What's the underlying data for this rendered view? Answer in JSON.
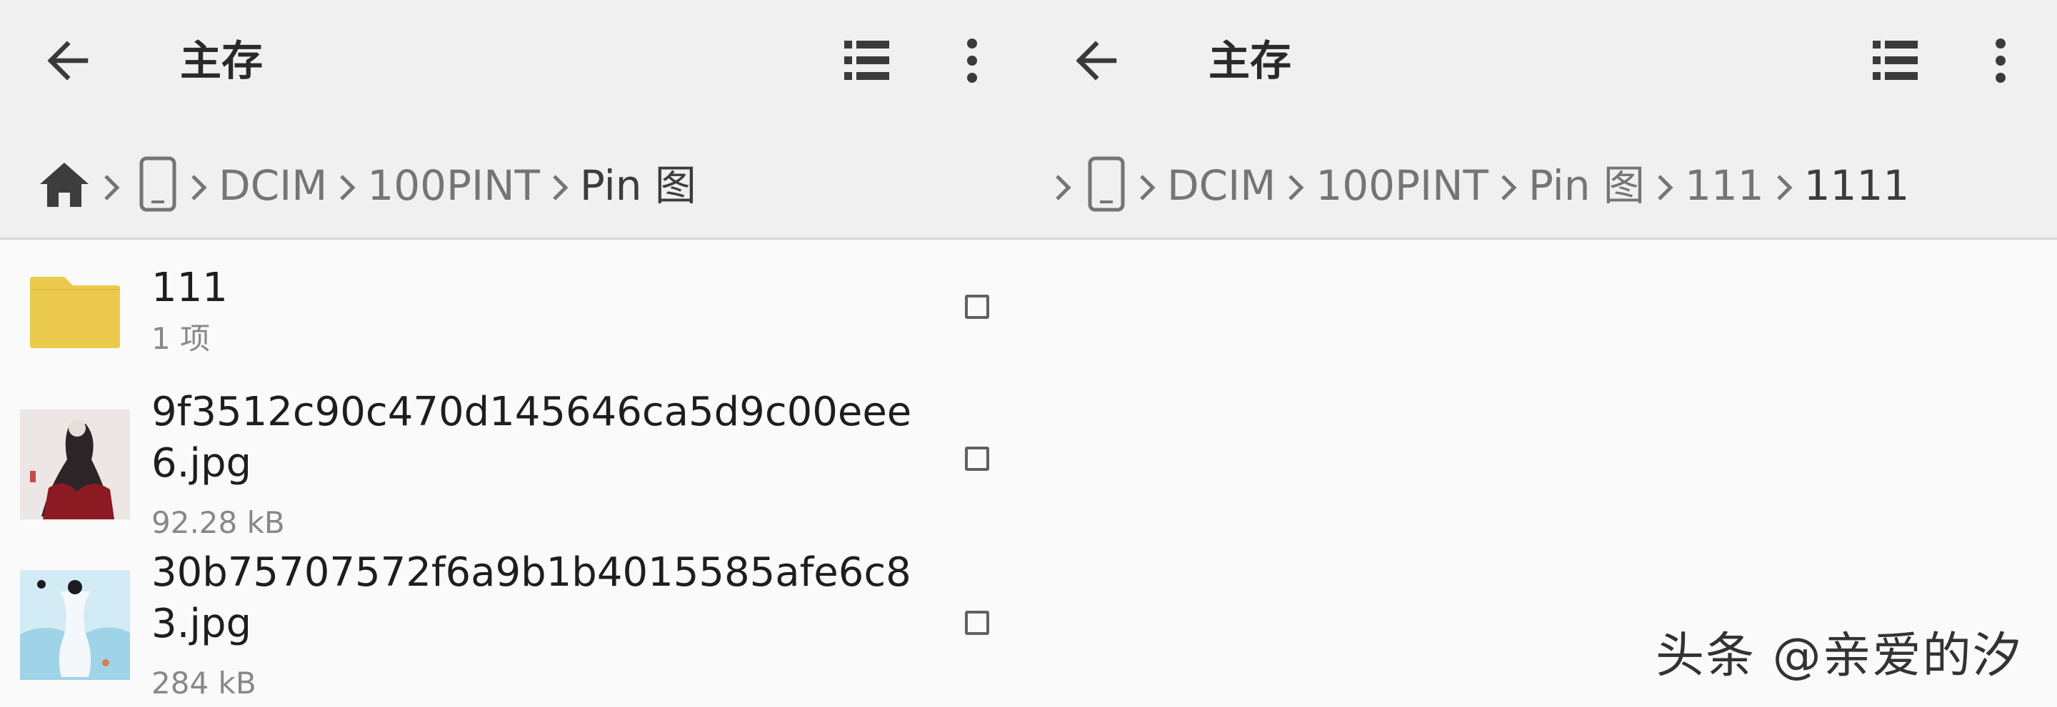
{
  "left_pane": {
    "title": "主存",
    "icons": {
      "back": "arrow-back-icon",
      "list_view": "list-view-icon",
      "more": "more-vert-icon"
    },
    "breadcrumb": {
      "home_icon": "home-icon",
      "device_icon": "phone-icon",
      "separator_icon": "chevron-right-icon",
      "items": [
        "DCIM",
        "100PINT",
        "Pin 图"
      ]
    },
    "files": [
      {
        "name": "111",
        "meta": "1 项",
        "type": "folder",
        "icon": "folder-icon",
        "color": "#ecca4e"
      },
      {
        "name": "9f3512c90c470d145646ca5d9c00eee\n6.jpg",
        "meta": "92.28 kB",
        "type": "image",
        "icon": "image-thumbnail"
      },
      {
        "name": "30b75707572f6a9b1b4015585afe6c8\n3.jpg",
        "meta": "284 kB",
        "type": "image",
        "icon": "image-thumbnail"
      }
    ]
  },
  "right_pane": {
    "title": "主存",
    "icons": {
      "back": "arrow-back-icon",
      "list_view": "list-view-icon",
      "more": "more-vert-icon"
    },
    "breadcrumb": {
      "device_icon": "phone-icon",
      "separator_icon": "chevron-right-icon",
      "items": [
        "DCIM",
        "100PINT",
        "Pin 图",
        "111",
        "1111"
      ]
    }
  },
  "watermark": "头条 @亲爱的汐",
  "colors": {
    "header_bg": "#f0f0f0",
    "list_bg": "#fafafa",
    "folder": "#ecca4e",
    "text_primary": "#212121",
    "text_secondary": "#888888"
  }
}
